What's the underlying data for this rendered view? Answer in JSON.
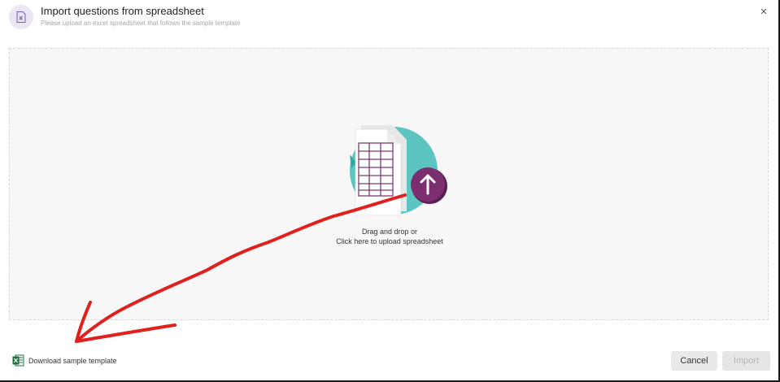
{
  "header": {
    "title": "Import questions from spreadsheet",
    "subtitle": "Please upload an excel spreadsheet that follows the sample template",
    "icon": "excel-file-icon",
    "close_icon": "close-icon"
  },
  "dropzone": {
    "line1": "Drag and drop or",
    "line2": "Click here to upload spreadsheet",
    "icon": "upload-spreadsheet-icon"
  },
  "footer": {
    "download_label": "Download sample template",
    "download_icon": "excel-icon",
    "cancel_label": "Cancel",
    "import_label": "Import"
  },
  "colors": {
    "accent_purple": "#6b2a63",
    "teal": "#59c4c0",
    "annotation_red": "#e0201c",
    "excel_green": "#1d6f42"
  }
}
